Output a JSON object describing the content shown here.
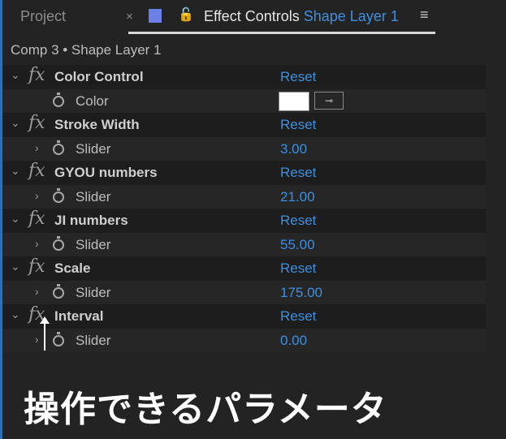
{
  "tabs": {
    "project": "Project",
    "close": "×",
    "lock": "🔓",
    "effect_controls": "Effect Controls",
    "layer": "Shape Layer 1",
    "menu": "≡"
  },
  "breadcrumb": "Comp 3 • Shape Layer 1",
  "effects": [
    {
      "name": "Color Control",
      "reset": "Reset",
      "param": "Color",
      "value": "",
      "color": "#ffffff"
    },
    {
      "name": "Stroke Width",
      "reset": "Reset",
      "param": "Slider",
      "value": "3.00"
    },
    {
      "name": "GYOU numbers",
      "reset": "Reset",
      "param": "Slider",
      "value": "21.00"
    },
    {
      "name": "JI numbers",
      "reset": "Reset",
      "param": "Slider",
      "value": "55.00"
    },
    {
      "name": "Scale",
      "reset": "Reset",
      "param": "Slider",
      "value": "175.00"
    },
    {
      "name": "Interval",
      "reset": "Reset",
      "param": "Slider",
      "value": "0.00"
    }
  ],
  "caption": "操作できるパラメータ"
}
